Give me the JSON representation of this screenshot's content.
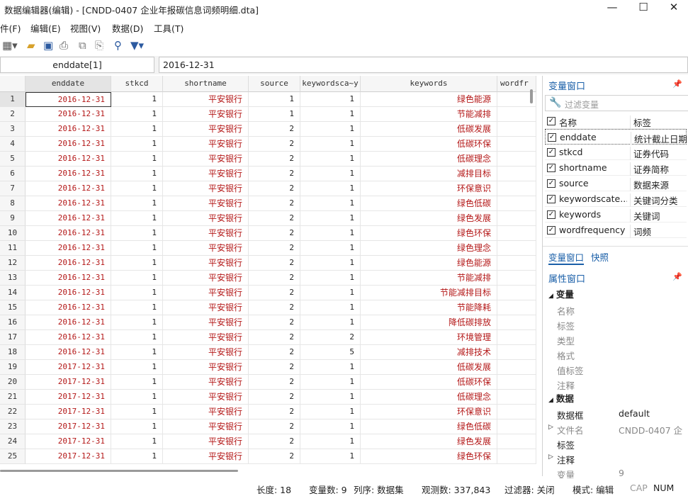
{
  "window": {
    "title": "数据编辑器(编辑) - [CNDD-0407 企业年报碳信息词频明细.dta]"
  },
  "menu": [
    "件(F)",
    "编辑(E)",
    "视图(V)",
    "数据(D)",
    "工具(T)"
  ],
  "cmd": {
    "varname": "enddate[1]",
    "value": "2016-12-31"
  },
  "columns": [
    "enddate",
    "stkcd",
    "shortname",
    "source",
    "keywordsca~y",
    "keywords",
    "wordfr"
  ],
  "rows": [
    [
      "1",
      "2016-12-31",
      "1",
      "平安银行",
      "1",
      "1",
      "绿色能源"
    ],
    [
      "2",
      "2016-12-31",
      "1",
      "平安银行",
      "1",
      "1",
      "节能减排"
    ],
    [
      "3",
      "2016-12-31",
      "1",
      "平安银行",
      "2",
      "1",
      "低碳发展"
    ],
    [
      "4",
      "2016-12-31",
      "1",
      "平安银行",
      "2",
      "1",
      "低碳环保"
    ],
    [
      "5",
      "2016-12-31",
      "1",
      "平安银行",
      "2",
      "1",
      "低碳理念"
    ],
    [
      "6",
      "2016-12-31",
      "1",
      "平安银行",
      "2",
      "1",
      "减排目标"
    ],
    [
      "7",
      "2016-12-31",
      "1",
      "平安银行",
      "2",
      "1",
      "环保意识"
    ],
    [
      "8",
      "2016-12-31",
      "1",
      "平安银行",
      "2",
      "1",
      "绿色低碳"
    ],
    [
      "9",
      "2016-12-31",
      "1",
      "平安银行",
      "2",
      "1",
      "绿色发展"
    ],
    [
      "10",
      "2016-12-31",
      "1",
      "平安银行",
      "2",
      "1",
      "绿色环保"
    ],
    [
      "11",
      "2016-12-31",
      "1",
      "平安银行",
      "2",
      "1",
      "绿色理念"
    ],
    [
      "12",
      "2016-12-31",
      "1",
      "平安银行",
      "2",
      "1",
      "绿色能源"
    ],
    [
      "13",
      "2016-12-31",
      "1",
      "平安银行",
      "2",
      "1",
      "节能减排"
    ],
    [
      "14",
      "2016-12-31",
      "1",
      "平安银行",
      "2",
      "1",
      "节能减排目标"
    ],
    [
      "15",
      "2016-12-31",
      "1",
      "平安银行",
      "2",
      "1",
      "节能降耗"
    ],
    [
      "16",
      "2016-12-31",
      "1",
      "平安银行",
      "2",
      "1",
      "降低碳排放"
    ],
    [
      "17",
      "2016-12-31",
      "1",
      "平安银行",
      "2",
      "2",
      "环境管理"
    ],
    [
      "18",
      "2016-12-31",
      "1",
      "平安银行",
      "2",
      "5",
      "减排技术"
    ],
    [
      "19",
      "2017-12-31",
      "1",
      "平安银行",
      "2",
      "1",
      "低碳发展"
    ],
    [
      "20",
      "2017-12-31",
      "1",
      "平安银行",
      "2",
      "1",
      "低碳环保"
    ],
    [
      "21",
      "2017-12-31",
      "1",
      "平安银行",
      "2",
      "1",
      "低碳理念"
    ],
    [
      "22",
      "2017-12-31",
      "1",
      "平安银行",
      "2",
      "1",
      "环保意识"
    ],
    [
      "23",
      "2017-12-31",
      "1",
      "平安银行",
      "2",
      "1",
      "绿色低碳"
    ],
    [
      "24",
      "2017-12-31",
      "1",
      "平安银行",
      "2",
      "1",
      "绿色发展"
    ],
    [
      "25",
      "2017-12-31",
      "1",
      "平安银行",
      "2",
      "1",
      "绿色环保"
    ]
  ],
  "varwin": {
    "title": "变量窗口",
    "filter_placeholder": "过滤变量",
    "head_name": "名称",
    "head_label": "标签",
    "vars": [
      {
        "name": "enddate",
        "label": "统计截止日期"
      },
      {
        "name": "stkcd",
        "label": "证券代码"
      },
      {
        "name": "shortname",
        "label": "证券简称"
      },
      {
        "name": "source",
        "label": "数据来源"
      },
      {
        "name": "keywordscate...",
        "label": "关键词分类"
      },
      {
        "name": "keywords",
        "label": "关键词"
      },
      {
        "name": "wordfrequency",
        "label": "词频"
      }
    ],
    "tab1": "变量窗口",
    "tab2": "快照"
  },
  "propwin": {
    "title": "属性窗口",
    "sec_var": "变量",
    "var_keys": [
      "名称",
      "标签",
      "类型",
      "格式",
      "值标签",
      "注释"
    ],
    "sec_data": "数据",
    "data_rows": [
      {
        "k": "数据框",
        "v": "default",
        "arrow": false,
        "bold": true
      },
      {
        "k": "文件名",
        "v": "CNDD-0407 企",
        "arrow": true,
        "bold": false
      },
      {
        "k": "标签",
        "v": "",
        "arrow": false,
        "bold": true
      },
      {
        "k": "注释",
        "v": "",
        "arrow": true,
        "bold": true
      },
      {
        "k": "变量",
        "v": "9",
        "arrow": false,
        "bold": false
      }
    ]
  },
  "status": {
    "length": "长度: 18",
    "vars": "变量数: 9",
    "order": "列序: 数据集",
    "obs": "观测数: 337,843",
    "filter": "过滤器: 关闭",
    "mode": "模式: 编辑",
    "cap": "CAP",
    "num": "NUM"
  }
}
